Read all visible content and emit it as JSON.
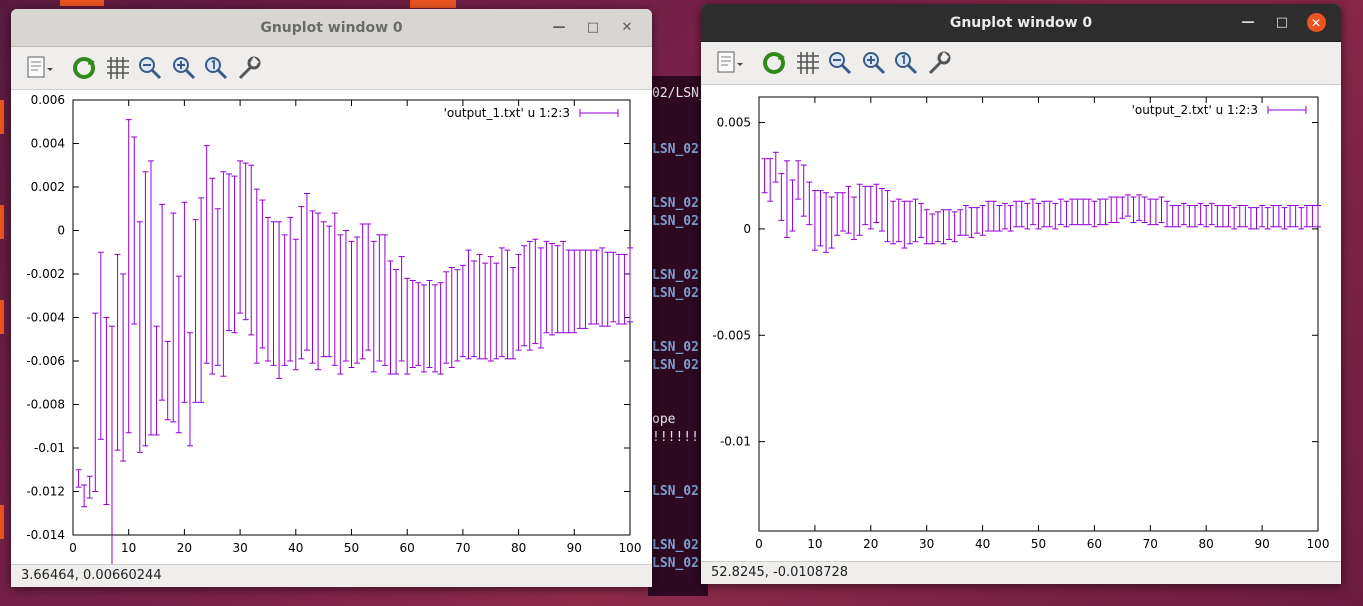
{
  "windows": [
    {
      "title": "Gnuplot window 0",
      "active": false,
      "status": "3.66464,  0.00660244",
      "chart_data": {
        "type": "errorbar",
        "series": [
          {
            "name": "'output_1.txt' u 1:2:3",
            "color": "#9400d3"
          }
        ],
        "xlim": [
          0,
          100
        ],
        "ylim": [
          -0.014,
          0.006
        ],
        "xticks": [
          0,
          10,
          20,
          30,
          40,
          50,
          60,
          70,
          80,
          90,
          100
        ],
        "xtick_labels": [
          "0",
          "10",
          "20",
          "30",
          "40",
          "50",
          "60",
          "70",
          "80",
          "90",
          "100"
        ],
        "yticks": [
          -0.014,
          -0.012,
          -0.01,
          -0.008,
          -0.006,
          -0.004,
          -0.002,
          0,
          0.002,
          0.004,
          0.006
        ],
        "ytick_labels": [
          "-0.014",
          "-0.012",
          "-0.01",
          "-0.008",
          "-0.006",
          "-0.004",
          "-0.002",
          "0",
          "0.002",
          "0.004",
          "0.006"
        ],
        "x": [
          1,
          2,
          3,
          4,
          5,
          6,
          7,
          8,
          9,
          10,
          11,
          12,
          13,
          14,
          15,
          16,
          17,
          18,
          19,
          20,
          21,
          22,
          23,
          24,
          25,
          26,
          27,
          28,
          29,
          30,
          31,
          32,
          33,
          34,
          35,
          36,
          37,
          38,
          39,
          40,
          41,
          42,
          43,
          44,
          45,
          46,
          47,
          48,
          49,
          50,
          51,
          52,
          53,
          54,
          55,
          56,
          57,
          58,
          59,
          60,
          61,
          62,
          63,
          64,
          65,
          66,
          67,
          68,
          69,
          70,
          71,
          72,
          73,
          74,
          75,
          76,
          77,
          78,
          79,
          80,
          81,
          82,
          83,
          84,
          85,
          86,
          87,
          88,
          89,
          90,
          91,
          92,
          93,
          94,
          95,
          96,
          97,
          98,
          99,
          100
        ],
        "y": [
          -0.0114,
          -0.0122,
          -0.0118,
          -0.0079,
          -0.0053,
          -0.0083,
          -0.0099,
          -0.0056,
          -0.0063,
          -0.0021,
          0.0,
          -0.0049,
          -0.0036,
          -0.0031,
          -0.0069,
          -0.0033,
          -0.0069,
          -0.004,
          -0.0057,
          -0.0033,
          -0.0073,
          -0.0037,
          -0.0032,
          -0.0011,
          -0.0021,
          -0.0026,
          -0.002,
          -0.001,
          -0.0011,
          -0.0003,
          -0.0005,
          -0.0009,
          -0.0021,
          -0.002,
          -0.0027,
          -0.0029,
          -0.0032,
          -0.0032,
          -0.0027,
          -0.0034,
          -0.0024,
          -0.0019,
          -0.0026,
          -0.0028,
          -0.0027,
          -0.0028,
          -0.0027,
          -0.0034,
          -0.003,
          -0.0034,
          -0.0032,
          -0.0028,
          -0.0026,
          -0.0035,
          -0.0031,
          -0.0032,
          -0.004,
          -0.0042,
          -0.0036,
          -0.0044,
          -0.0043,
          -0.0043,
          -0.0045,
          -0.0043,
          -0.0045,
          -0.0045,
          -0.004,
          -0.004,
          -0.0039,
          -0.0037,
          -0.0034,
          -0.0036,
          -0.0035,
          -0.0037,
          -0.0036,
          -0.0037,
          -0.0033,
          -0.0034,
          -0.0038,
          -0.0033,
          -0.003,
          -0.003,
          -0.0028,
          -0.0031,
          -0.0026,
          -0.0027,
          -0.0027,
          -0.0026,
          -0.0028,
          -0.0028,
          -0.0027,
          -0.0027,
          -0.0026,
          -0.0026,
          -0.0026,
          -0.0027,
          -0.0026,
          -0.0027,
          -0.0027,
          -0.0025
        ],
        "yerr": [
          0.0004,
          0.0005,
          0.0005,
          0.0041,
          0.0043,
          0.0043,
          0.0055,
          0.0045,
          0.0043,
          0.0072,
          0.0043,
          0.0053,
          0.0063,
          0.0063,
          0.0025,
          0.0045,
          0.0018,
          0.0048,
          0.0036,
          0.0046,
          0.0026,
          0.0042,
          0.0047,
          0.005,
          0.0045,
          0.0036,
          0.0047,
          0.0036,
          0.0036,
          0.0035,
          0.0036,
          0.0039,
          0.004,
          0.0034,
          0.0033,
          0.0033,
          0.0036,
          0.003,
          0.0033,
          0.003,
          0.0035,
          0.0036,
          0.0035,
          0.0036,
          0.0031,
          0.003,
          0.0035,
          0.0032,
          0.003,
          0.0029,
          0.0029,
          0.0031,
          0.0029,
          0.003,
          0.0029,
          0.003,
          0.0026,
          0.0024,
          0.0024,
          0.0022,
          0.002,
          0.0019,
          0.002,
          0.002,
          0.002,
          0.0021,
          0.0021,
          0.0023,
          0.0021,
          0.0021,
          0.0025,
          0.0022,
          0.0024,
          0.0022,
          0.0024,
          0.0022,
          0.0025,
          0.0025,
          0.0021,
          0.0022,
          0.0023,
          0.0025,
          0.0024,
          0.0023,
          0.0021,
          0.0021,
          0.002,
          0.0021,
          0.0019,
          0.0019,
          0.0018,
          0.0018,
          0.0017,
          0.0017,
          0.0018,
          0.0017,
          0.0016,
          0.0016,
          0.0016,
          0.0017
        ]
      }
    },
    {
      "title": "Gnuplot window 0",
      "active": true,
      "status": "52.8245, -0.0108728",
      "chart_data": {
        "type": "errorbar",
        "series": [
          {
            "name": "'output_2.txt' u 1:2:3",
            "color": "#9400d3"
          }
        ],
        "xlim": [
          0,
          100
        ],
        "ylim": [
          -0.014,
          0.006
        ],
        "xticks": [
          0,
          10,
          20,
          30,
          40,
          50,
          60,
          70,
          80,
          90,
          100
        ],
        "xtick_labels": [
          "0",
          "10",
          "20",
          "30",
          "40",
          "50",
          "60",
          "70",
          "80",
          "90",
          "100"
        ],
        "yticks": [
          -0.01,
          -0.005,
          0,
          0.005
        ],
        "ytick_labels": [
          "-0.01",
          "-0.005",
          "0",
          "0.005"
        ],
        "x": [
          1,
          2,
          3,
          4,
          5,
          6,
          7,
          8,
          9,
          10,
          11,
          12,
          13,
          14,
          15,
          16,
          17,
          18,
          19,
          20,
          21,
          22,
          23,
          24,
          25,
          26,
          27,
          28,
          29,
          30,
          31,
          32,
          33,
          34,
          35,
          36,
          37,
          38,
          39,
          40,
          41,
          42,
          43,
          44,
          45,
          46,
          47,
          48,
          49,
          50,
          51,
          52,
          53,
          54,
          55,
          56,
          57,
          58,
          59,
          60,
          61,
          62,
          63,
          64,
          65,
          66,
          67,
          68,
          69,
          70,
          71,
          72,
          73,
          74,
          75,
          76,
          77,
          78,
          79,
          80,
          81,
          82,
          83,
          84,
          85,
          86,
          87,
          88,
          89,
          90,
          91,
          92,
          93,
          94,
          95,
          96,
          97,
          98,
          99,
          100
        ],
        "y": [
          0.0025,
          0.0023,
          0.0029,
          0.0015,
          0.0014,
          0.0011,
          0.0023,
          0.0018,
          0.0012,
          0.0004,
          0.0005,
          0.0003,
          0.0003,
          0.0007,
          0.0008,
          0.0009,
          0.0005,
          0.0009,
          0.0011,
          0.001,
          0.0012,
          0.0009,
          0.0006,
          0.0003,
          0.0004,
          0.0002,
          0.0003,
          0.0004,
          0.0004,
          0.0001,
          0.0,
          0.0001,
          0.0001,
          0.0002,
          0.0001,
          0.0003,
          0.0004,
          0.0003,
          0.0004,
          0.0004,
          0.0006,
          0.0006,
          0.0005,
          0.0006,
          0.0005,
          0.0007,
          0.0007,
          0.0006,
          0.0008,
          0.0006,
          0.0007,
          0.0007,
          0.0006,
          0.0008,
          0.0007,
          0.0008,
          0.0008,
          0.0008,
          0.0008,
          0.0007,
          0.0008,
          0.0008,
          0.0009,
          0.0009,
          0.001,
          0.0011,
          0.0009,
          0.001,
          0.0009,
          0.0008,
          0.0008,
          0.0009,
          0.0007,
          0.0006,
          0.0006,
          0.0007,
          0.0006,
          0.0006,
          0.0007,
          0.0006,
          0.0007,
          0.0006,
          0.0006,
          0.0006,
          0.0005,
          0.0006,
          0.0006,
          0.0005,
          0.0005,
          0.0006,
          0.0005,
          0.0006,
          0.0006,
          0.0005,
          0.0006,
          0.0006,
          0.0005,
          0.0006,
          0.0006,
          0.0006
        ],
        "yerr": [
          0.0008,
          0.001,
          0.0007,
          0.0011,
          0.0018,
          0.0012,
          0.0009,
          0.0012,
          0.001,
          0.0014,
          0.0013,
          0.0014,
          0.0012,
          0.001,
          0.0009,
          0.0011,
          0.001,
          0.0012,
          0.0009,
          0.001,
          0.0009,
          0.001,
          0.0012,
          0.001,
          0.001,
          0.0011,
          0.001,
          0.001,
          0.0008,
          0.0008,
          0.0007,
          0.0007,
          0.0008,
          0.0007,
          0.0007,
          0.0006,
          0.0007,
          0.0007,
          0.0006,
          0.0007,
          0.0007,
          0.0007,
          0.0006,
          0.0006,
          0.0006,
          0.0006,
          0.0006,
          0.0006,
          0.0006,
          0.0006,
          0.0006,
          0.0006,
          0.0006,
          0.0006,
          0.0006,
          0.0006,
          0.0006,
          0.0006,
          0.0006,
          0.0006,
          0.0006,
          0.0006,
          0.0006,
          0.0006,
          0.0005,
          0.0005,
          0.0006,
          0.0006,
          0.0006,
          0.0006,
          0.0006,
          0.0006,
          0.0006,
          0.0005,
          0.0005,
          0.0005,
          0.0005,
          0.0005,
          0.0005,
          0.0005,
          0.0005,
          0.0005,
          0.0005,
          0.0005,
          0.0005,
          0.0005,
          0.0005,
          0.0005,
          0.0005,
          0.0005,
          0.0005,
          0.0005,
          0.0005,
          0.0005,
          0.0005,
          0.0005,
          0.0005,
          0.0005,
          0.0005,
          0.0005
        ]
      }
    }
  ],
  "terminal": {
    "lines": [
      {
        "text": "02/LSN_",
        "color": "white",
        "top": 10
      },
      {
        "text": "LSN_02",
        "color": "blue",
        "top": 66
      },
      {
        "text": "LSN_02",
        "color": "blue",
        "top": 120
      },
      {
        "text": "LSN_02",
        "color": "blue",
        "top": 138
      },
      {
        "text": "LSN_02",
        "color": "blue",
        "top": 192
      },
      {
        "text": "LSN_02",
        "color": "blue",
        "top": 210
      },
      {
        "text": "LSN_02",
        "color": "blue",
        "top": 264
      },
      {
        "text": "LSN_02",
        "color": "blue",
        "top": 282
      },
      {
        "text": "ope",
        "color": "white",
        "top": 336
      },
      {
        "text": "!!!!!!",
        "color": "white",
        "top": 354
      },
      {
        "text": "LSN_02",
        "color": "blue",
        "top": 408
      },
      {
        "text": "LSN_02",
        "color": "blue",
        "top": 462
      },
      {
        "text": "LSN_02",
        "color": "blue",
        "top": 480
      }
    ]
  },
  "toolbar_icons": [
    "export-icon",
    "replot-icon",
    "grid-icon",
    "zoom-out-icon",
    "zoom-in-icon",
    "zoom-reset-icon",
    "config-icon"
  ]
}
